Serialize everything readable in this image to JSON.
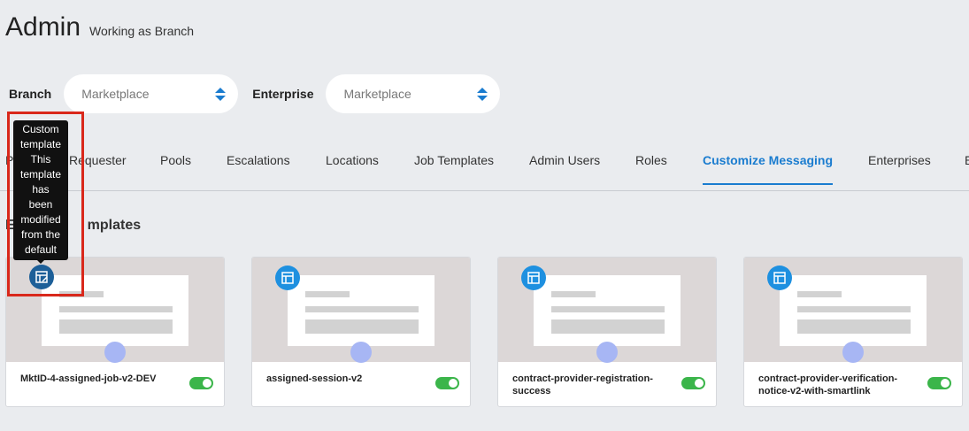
{
  "header": {
    "title": "Admin",
    "subtitle": "Working as Branch"
  },
  "filters": {
    "branch_label": "Branch",
    "branch_value": "Marketplace",
    "enterprise_label": "Enterprise",
    "enterprise_value": "Marketplace"
  },
  "tabs": [
    {
      "label": "Pr"
    },
    {
      "label": "Requester"
    },
    {
      "label": "Pools"
    },
    {
      "label": "Escalations"
    },
    {
      "label": "Locations"
    },
    {
      "label": "Job Templates"
    },
    {
      "label": "Admin Users"
    },
    {
      "label": "Roles"
    },
    {
      "label": "Customize Messaging",
      "active": true
    },
    {
      "label": "Enterprises"
    },
    {
      "label": "E"
    }
  ],
  "section": {
    "title_start": "E",
    "title_end": "mplates"
  },
  "tooltip": {
    "text_lines": [
      "Custom",
      "template",
      "This",
      "template",
      "has",
      "been",
      "modified",
      "from the",
      "default"
    ]
  },
  "cards": [
    {
      "name": "MktID-4-assigned-job-v2-DEV",
      "enabled": true,
      "icon": "custom-template-icon"
    },
    {
      "name": "assigned-session-v2",
      "enabled": true,
      "icon": "template-icon"
    },
    {
      "name": "contract-provider-registration-success",
      "enabled": true,
      "icon": "template-icon"
    },
    {
      "name": "contract-provider-verification-notice-v2-with-smartlink",
      "enabled": true,
      "icon": "template-icon"
    }
  ],
  "colors": {
    "accent": "#1a7ccf",
    "toggle_on": "#3bb54a",
    "highlight": "#d9281b",
    "background": "#eaecef"
  }
}
